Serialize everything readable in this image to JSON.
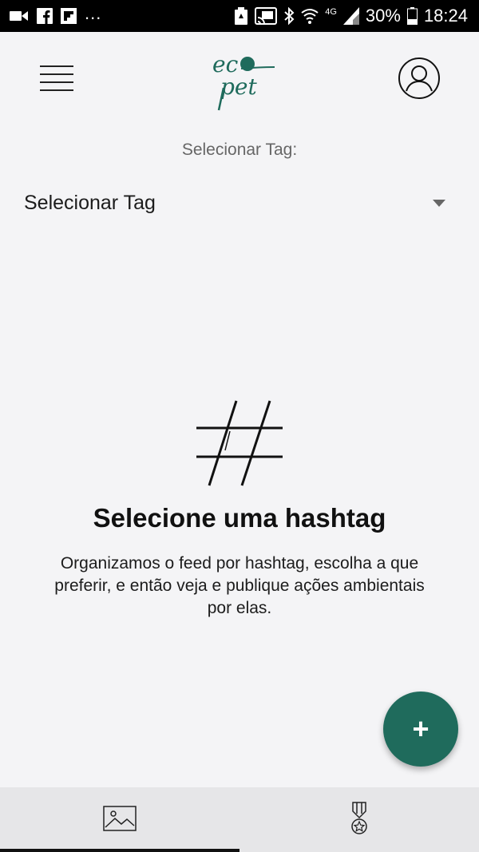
{
  "status_bar": {
    "battery": "30%",
    "time": "18:24",
    "network": "4G",
    "overflow": "...",
    "icons": [
      "video-icon",
      "facebook-icon",
      "flipboard-icon",
      "battery-saver-icon",
      "cast-icon",
      "bluetooth-icon",
      "wifi-icon",
      "signal-icon",
      "battery-icon"
    ]
  },
  "header": {
    "logo": "eco pet",
    "menu_icon": "hamburger-menu-icon",
    "profile_icon": "user-profile-icon"
  },
  "tag_filter": {
    "label": "Selecionar Tag:",
    "selected_value": "Selecionar Tag"
  },
  "empty_state": {
    "icon": "hashtag-icon",
    "title": "Selecione uma hashtag",
    "description": "Organizamos o feed por hashtag, escolha a que preferir, e então veja e publique ações ambientais por elas."
  },
  "fab": {
    "icon": "plus-icon",
    "label": "+"
  },
  "bottom_nav": {
    "items": [
      {
        "icon": "image-icon",
        "active": true
      },
      {
        "icon": "medal-icon",
        "active": false
      }
    ]
  },
  "colors": {
    "brand": "#1f6b5c",
    "background": "#f4f4f6",
    "status_bar": "#000000"
  }
}
